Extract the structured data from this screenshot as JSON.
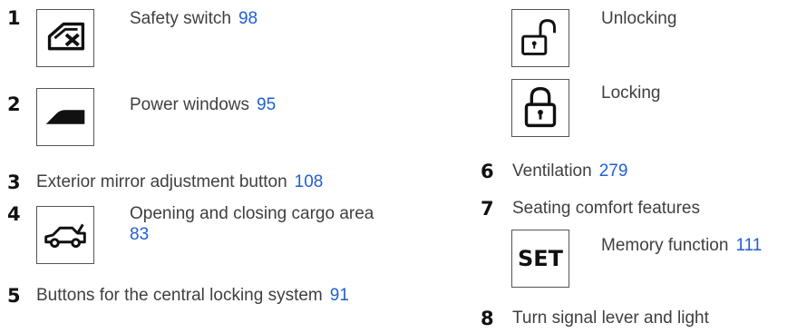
{
  "left_items": [
    {
      "num": "1",
      "label": "Safety switch",
      "page": "98",
      "icon": "window-safety-switch-icon"
    },
    {
      "num": "2",
      "label": "Power windows",
      "page": "95",
      "icon": "power-window-icon"
    },
    {
      "num": "3",
      "label": "Exterior mirror adjustment button",
      "page": "108"
    },
    {
      "num": "4",
      "label_line1": "Opening and closing cargo area",
      "page": "83",
      "icon": "car-trunk-icon"
    },
    {
      "num": "5",
      "label": "Buttons for the central locking system",
      "page": "91"
    }
  ],
  "right_items": {
    "unlocking": {
      "label": "Unlocking",
      "icon": "unlock-icon"
    },
    "locking": {
      "label": "Locking",
      "icon": "lock-icon"
    },
    "ventilation": {
      "num": "6",
      "label": "Ventilation",
      "page": "279"
    },
    "seating": {
      "num": "7",
      "label": "Seating comfort features"
    },
    "memory": {
      "label": "Memory function",
      "page": "111",
      "icon_text": "SET"
    },
    "turn_signal": {
      "num": "8",
      "label": "Turn signal lever and light"
    }
  },
  "colors": {
    "link": "#1f5fd6",
    "text": "#3f3f3f",
    "number": "#111111"
  }
}
